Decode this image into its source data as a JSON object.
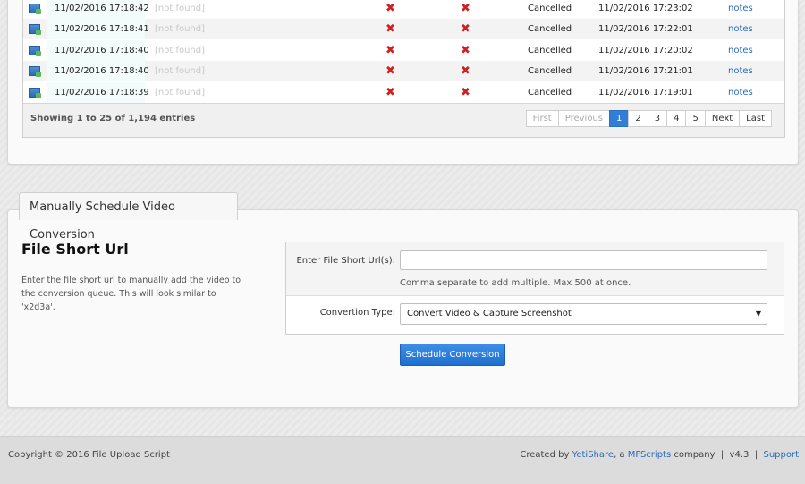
{
  "table": {
    "rows": [
      {
        "date": "11/02/2016 17:18:42",
        "file": "[not found]",
        "status": "Cancelled",
        "completed": "11/02/2016 17:23:02",
        "notes": "notes"
      },
      {
        "date": "11/02/2016 17:18:41",
        "file": "[not found]",
        "status": "Cancelled",
        "completed": "11/02/2016 17:22:01",
        "notes": "notes"
      },
      {
        "date": "11/02/2016 17:18:40",
        "file": "[not found]",
        "status": "Cancelled",
        "completed": "11/02/2016 17:20:02",
        "notes": "notes"
      },
      {
        "date": "11/02/2016 17:18:40",
        "file": "[not found]",
        "status": "Cancelled",
        "completed": "11/02/2016 17:21:01",
        "notes": "notes"
      },
      {
        "date": "11/02/2016 17:18:39",
        "file": "[not found]",
        "status": "Cancelled",
        "completed": "11/02/2016 17:19:01",
        "notes": "notes"
      }
    ],
    "cross_glyph": "✖",
    "showing": "Showing 1 to 25 of 1,194 entries",
    "pager": {
      "first": "First",
      "previous": "Previous",
      "pages": [
        "1",
        "2",
        "3",
        "4",
        "5"
      ],
      "next": "Next",
      "last": "Last"
    }
  },
  "tab": {
    "label": "Manually Schedule Video Conversion"
  },
  "section": {
    "title": "File Short Url",
    "description": "Enter the file short url to manually add the video to the conversion queue. This will look similar to 'x2d3a'."
  },
  "form": {
    "url_label": "Enter File Short Url(s):",
    "url_value": "",
    "url_hint": "Comma separate to add multiple. Max 500 at once.",
    "type_label": "Convertion Type:",
    "type_selected": "Convert Video & Capture Screenshot",
    "submit_label": "Schedule Conversion"
  },
  "footer": {
    "copyright": "Copyright © 2016 File Upload Script",
    "created_by": "Created by",
    "yetishare": "YetiShare",
    "a": ", a",
    "mfscripts": "MFScripts",
    "company": "company",
    "sep1": "|",
    "version": "v4.3",
    "sep2": "|",
    "support": "Support"
  },
  "colors": {
    "accent": "#2f7ed8",
    "link": "#2a6db6",
    "error": "#cc2222"
  }
}
